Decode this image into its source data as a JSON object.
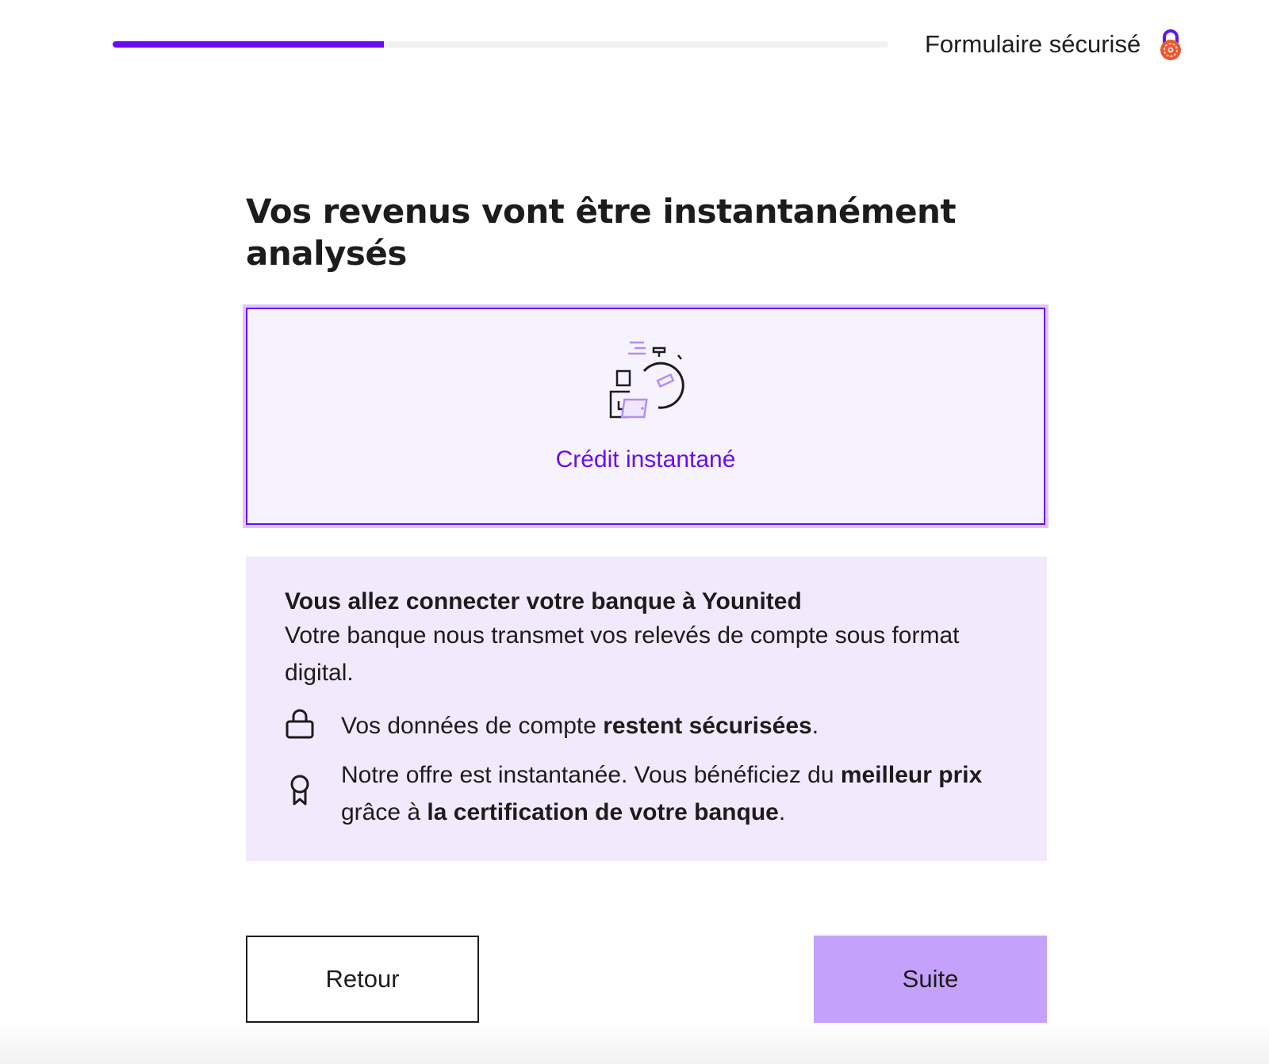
{
  "header": {
    "progress_percent": 35,
    "progress_color": "#6a0af6",
    "secure_label": "Formulaire sécurisé",
    "secure_icon": "padlock-badge-icon"
  },
  "main": {
    "title": "Vos revenus vont être instantanément analysés",
    "option": {
      "icon": "stopwatch-documents-icon",
      "label": "Crédit instantané",
      "selected": true
    },
    "info": {
      "title": "Vous allez connecter votre banque à Younited",
      "text": "Votre banque nous transmet vos relevés de compte sous format digital.",
      "rows": [
        {
          "icon": "lock-icon",
          "parts": [
            "Vos données de compte ",
            "restent sécurisées",
            "."
          ]
        },
        {
          "icon": "award-ribbon-icon",
          "parts": [
            "Notre offre est instantanée. Vous bénéficiez du ",
            "meilleur prix",
            " grâce à ",
            "la certification de votre banque",
            "."
          ]
        }
      ]
    },
    "buttons": {
      "back": "Retour",
      "next": "Suite"
    }
  },
  "colors": {
    "accent": "#6a0af6",
    "card_bg": "#f7f3fe",
    "info_bg": "#f2e9fd",
    "next_button_bg": "#c4a1fa"
  }
}
